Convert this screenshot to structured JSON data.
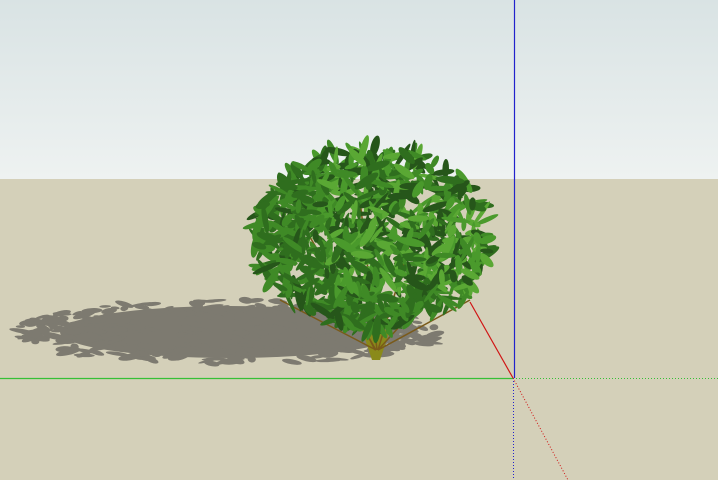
{
  "scene": {
    "sky_top_color": "#d9e3e4",
    "sky_bottom_color": "#eef2f1",
    "ground_color": "#d4d0b9",
    "shadow_color": "#7d7a70",
    "foliage_colors": [
      "#2f6e1e",
      "#3f8a26",
      "#4a9a2c",
      "#5aa834",
      "#26561a"
    ],
    "trunk_color": "#8a8a1a",
    "axes": {
      "red_axis_color": "#d01414",
      "green_axis_color": "#36c036",
      "blue_axis_color": "#2222cc"
    },
    "objects": [
      {
        "type": "shrub",
        "name": "bush-component"
      }
    ]
  }
}
